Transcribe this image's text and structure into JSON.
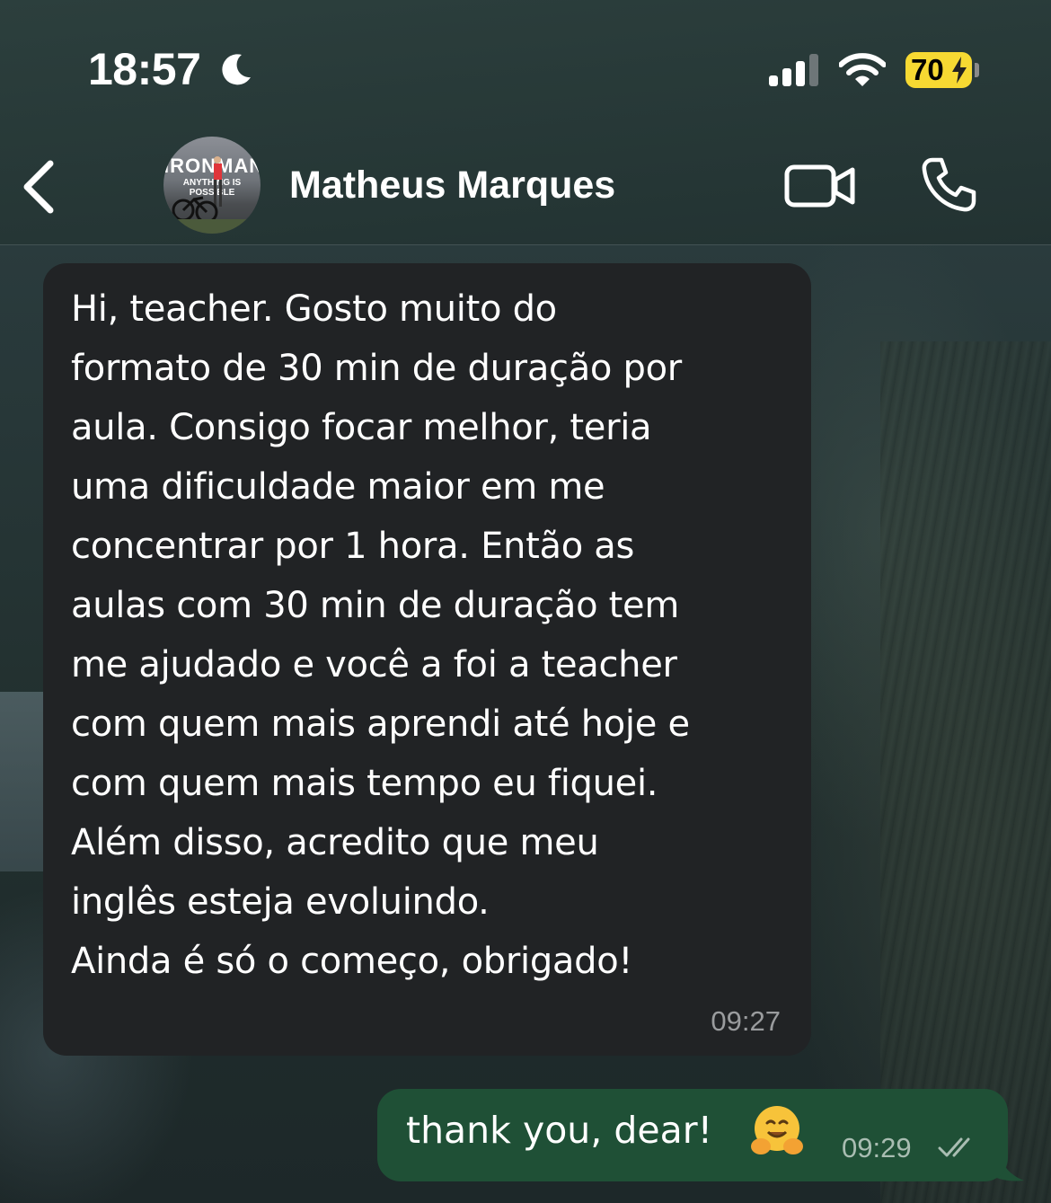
{
  "status_bar": {
    "time": "18:57",
    "battery_percent": "70",
    "icons": [
      "moon-icon",
      "cellular-signal-icon",
      "wifi-icon",
      "battery-charging-icon"
    ]
  },
  "header": {
    "contact_name": "Matheus Marques",
    "avatar_text_top": "IRONMAN",
    "avatar_text_sub": "ANYTHING IS POSSIBLE",
    "icons": [
      "back-chevron-icon",
      "video-call-icon",
      "phone-call-icon"
    ]
  },
  "messages": [
    {
      "direction": "incoming",
      "text": "Hi, teacher. Gosto muito do\nformato de 30 min de duração por\naula. Consigo focar melhor, teria\numa dificuldade maior em me\nconcentrar por 1 hora. Então as\naulas com 30 min de duração tem\nme ajudado e você a foi a teacher\ncom quem mais aprendi até hoje e\ncom quem mais tempo eu fiquei.\nAlém disso, acredito que meu\ninglês esteja evoluindo.\nAinda é só o começo, obrigado!",
      "time": "09:27"
    },
    {
      "direction": "outgoing",
      "text": "thank you, dear!",
      "emoji": "hugging-face-emoji",
      "time": "09:29",
      "status": "read"
    }
  ],
  "colors": {
    "incoming_bubble": "#212325",
    "outgoing_bubble": "#1f5036",
    "battery_fill": "#f7d932",
    "timestamp": "#9a9c9e"
  }
}
